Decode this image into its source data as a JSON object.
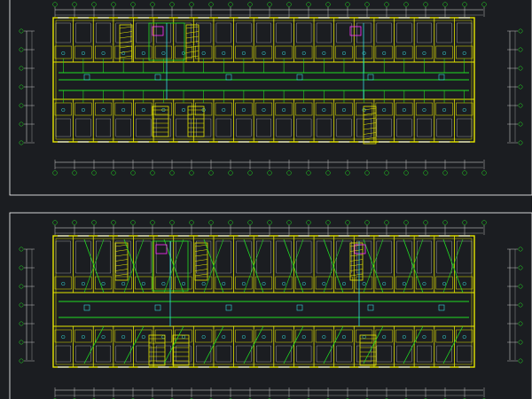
{
  "drawing": {
    "colors": {
      "background": "#1b1d21",
      "frame": "#ffffff",
      "wall": "#e6e600",
      "pipe": "#22dd22",
      "accent": "#ff33ff",
      "fixture": "#33dddd",
      "dimension": "#e8e8e8"
    }
  },
  "sheets": [
    {
      "title": "",
      "note": "",
      "pipe_style": "horizontal-mains"
    },
    {
      "title": "",
      "note": "",
      "pipe_style": "diagonal-risers"
    }
  ]
}
